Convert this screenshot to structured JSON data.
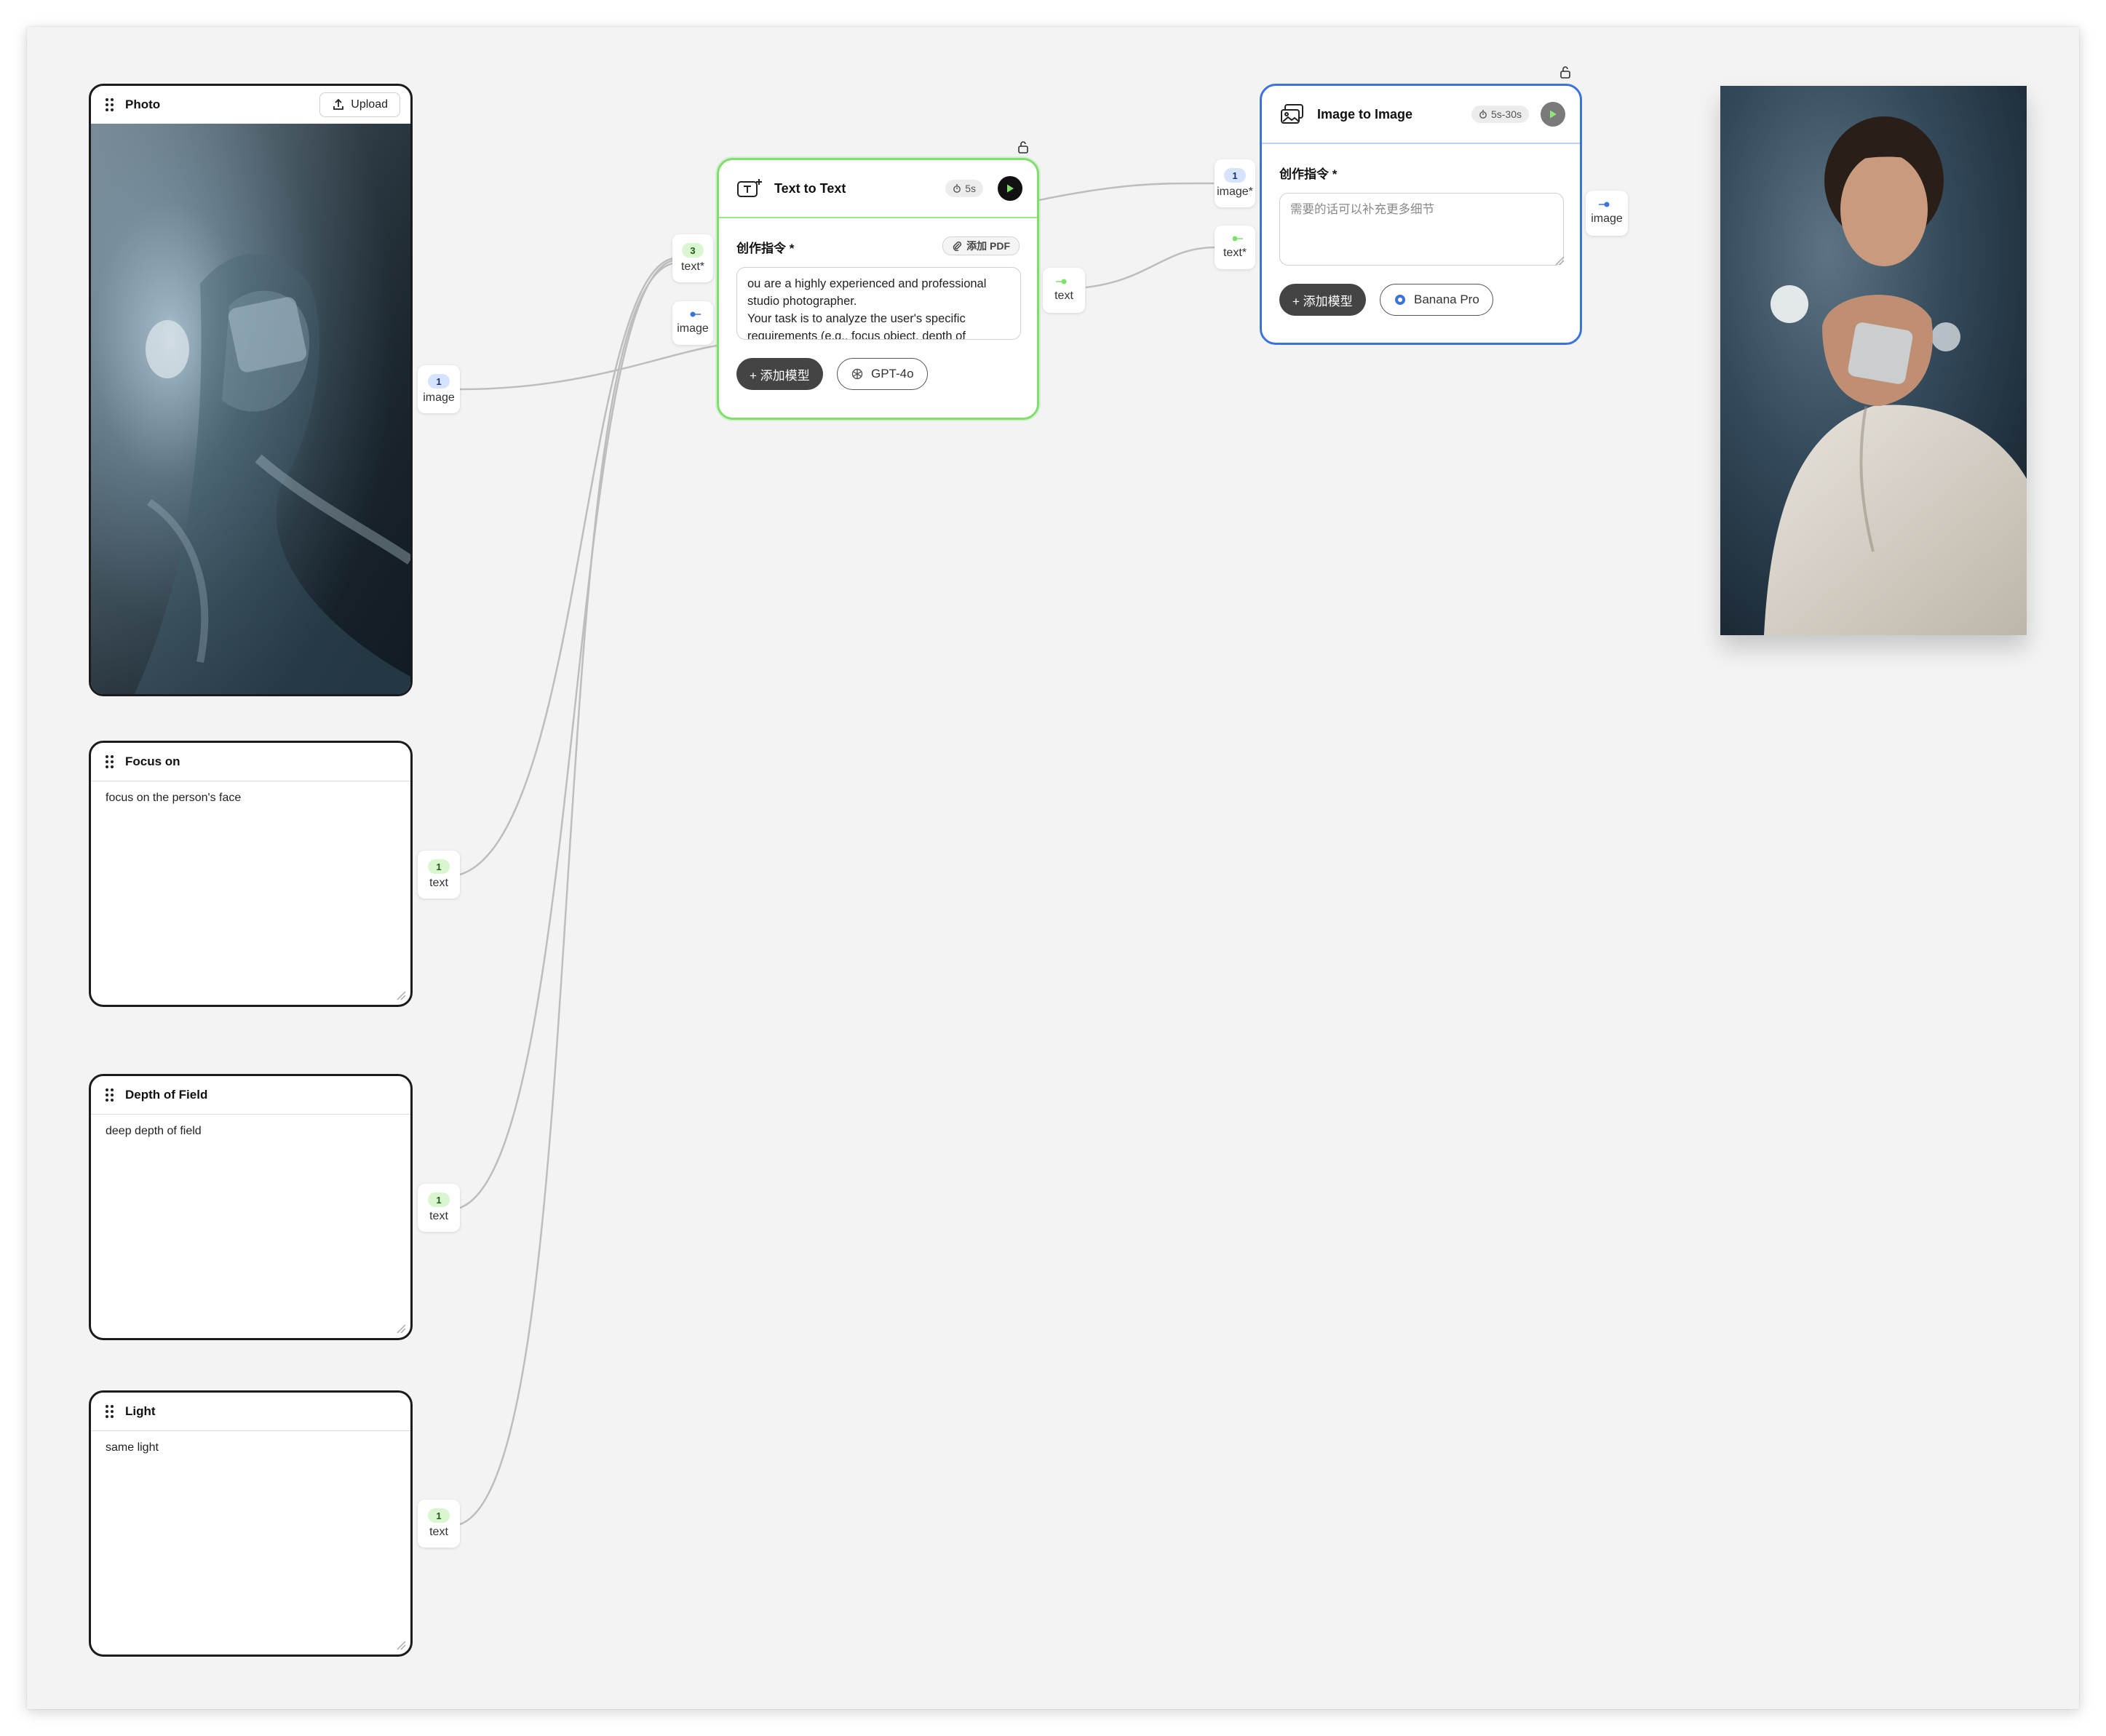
{
  "colors": {
    "canvas_bg": "#f3f3f3",
    "wire": "#bdbdbd",
    "text_node_accent": "#7ee06a",
    "image_node_accent": "#3a72e0",
    "port_image_badge": "#d6e3ff",
    "port_text_badge": "#d9f6d1"
  },
  "photo_node": {
    "title": "Photo",
    "upload_label": "Upload",
    "out_port": {
      "count": "1",
      "label": "image"
    }
  },
  "text_inputs": [
    {
      "title": "Focus on",
      "value": "focus on the person's face",
      "out_port": {
        "count": "1",
        "label": "text"
      }
    },
    {
      "title": "Depth of Field",
      "value": "deep depth of field",
      "out_port": {
        "count": "1",
        "label": "text"
      }
    },
    {
      "title": "Light",
      "value": "same light",
      "out_port": {
        "count": "1",
        "label": "text"
      }
    }
  ],
  "text_to_text": {
    "title": "Text to Text",
    "time": "5s",
    "section_label": "创作指令 *",
    "pdf_label": "添加 PDF",
    "prompt": "ou are a highly experienced and professional studio photographer.\nYour task is to analyze the user's specific requirements (e.g., focus object, depth of",
    "add_model_label": "+ 添加模型",
    "model_label": "GPT-4o",
    "in_ports": [
      {
        "count": "3",
        "label": "text*"
      },
      {
        "count": "",
        "label": "image"
      }
    ],
    "out_port": {
      "label": "text"
    }
  },
  "image_to_image": {
    "title": "Image to Image",
    "time": "5s-30s",
    "section_label": "创作指令 *",
    "prompt_placeholder": "需要的话可以补充更多细节",
    "add_model_label": "+ 添加模型",
    "model_label": "Banana Pro",
    "in_ports": [
      {
        "count": "1",
        "label": "image*"
      },
      {
        "count": "",
        "label": "text*"
      }
    ],
    "out_port": {
      "label": "image"
    }
  }
}
